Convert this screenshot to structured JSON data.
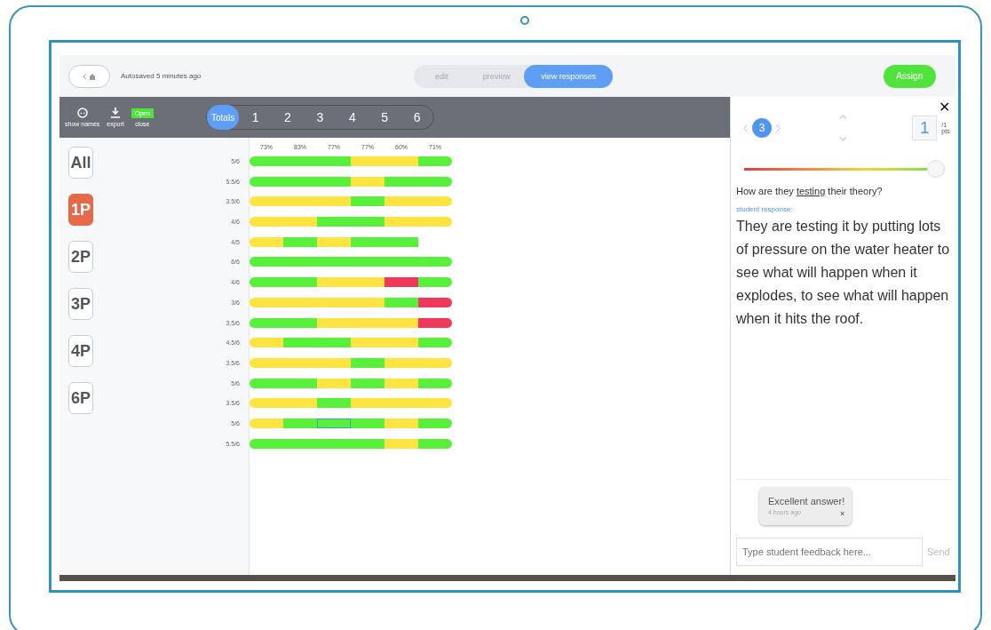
{
  "topbar": {
    "autosave": "Autosaved 5 minutes ago",
    "modes": [
      {
        "label": "edit",
        "selected": false
      },
      {
        "label": "preview",
        "selected": false
      },
      {
        "label": "view responses",
        "selected": true
      }
    ],
    "assign": "Assign"
  },
  "toolbar": {
    "show_names": "show names",
    "export": "export",
    "status_badge": "Open",
    "close": "close",
    "tabs": [
      {
        "label": "Totals",
        "selected": true
      },
      {
        "label": "1",
        "selected": false
      },
      {
        "label": "2",
        "selected": false
      },
      {
        "label": "3",
        "selected": false
      },
      {
        "label": "4",
        "selected": false
      },
      {
        "label": "5",
        "selected": false
      },
      {
        "label": "6",
        "selected": false
      }
    ]
  },
  "periods": [
    {
      "label": "All",
      "selected": false
    },
    {
      "label": "1P",
      "selected": true
    },
    {
      "label": "2P",
      "selected": false
    },
    {
      "label": "3P",
      "selected": false
    },
    {
      "label": "4P",
      "selected": false
    },
    {
      "label": "6P",
      "selected": false
    }
  ],
  "question_percents": [
    "73%",
    "83%",
    "77%",
    "77%",
    "60%",
    "71%"
  ],
  "rows": [
    {
      "score": "5/6",
      "segments": [
        {
          "color": "#58f03a",
          "selected": false
        },
        {
          "color": "#58f03a",
          "selected": false
        },
        {
          "color": "#58f03a",
          "selected": false
        },
        {
          "color": "#fde441",
          "selected": false
        },
        {
          "color": "#fde441",
          "selected": false
        },
        {
          "color": "#58f03a",
          "selected": false
        }
      ]
    },
    {
      "score": "5.5/6",
      "segments": [
        {
          "color": "#58f03a",
          "selected": false
        },
        {
          "color": "#58f03a",
          "selected": false
        },
        {
          "color": "#58f03a",
          "selected": false
        },
        {
          "color": "#fde441",
          "selected": false
        },
        {
          "color": "#58f03a",
          "selected": false
        },
        {
          "color": "#58f03a",
          "selected": false
        }
      ]
    },
    {
      "score": "3.5/6",
      "segments": [
        {
          "color": "#fde441",
          "selected": false
        },
        {
          "color": "#fde441",
          "selected": false
        },
        {
          "color": "#fde441",
          "selected": false
        },
        {
          "color": "#58f03a",
          "selected": false
        },
        {
          "color": "#fde441",
          "selected": false
        },
        {
          "color": "#fde441",
          "selected": false
        }
      ]
    },
    {
      "score": "4/6",
      "segments": [
        {
          "color": "#fde441",
          "selected": false
        },
        {
          "color": "#fde441",
          "selected": false
        },
        {
          "color": "#58f03a",
          "selected": false
        },
        {
          "color": "#58f03a",
          "selected": false
        },
        {
          "color": "#fde441",
          "selected": false
        },
        {
          "color": "#fde441",
          "selected": false
        }
      ]
    },
    {
      "score": "4/5",
      "segments": [
        {
          "color": "#fde441",
          "selected": false
        },
        {
          "color": "#58f03a",
          "selected": false
        },
        {
          "color": "#fde441",
          "selected": false
        },
        {
          "color": "#58f03a",
          "selected": false
        },
        {
          "color": "#58f03a",
          "selected": false
        }
      ]
    },
    {
      "score": "6/6",
      "segments": [
        {
          "color": "#58f03a",
          "selected": false
        },
        {
          "color": "#58f03a",
          "selected": false
        },
        {
          "color": "#58f03a",
          "selected": false
        },
        {
          "color": "#58f03a",
          "selected": false
        },
        {
          "color": "#58f03a",
          "selected": false
        },
        {
          "color": "#58f03a",
          "selected": false
        }
      ]
    },
    {
      "score": "4/6",
      "segments": [
        {
          "color": "#58f03a",
          "selected": false
        },
        {
          "color": "#58f03a",
          "selected": false
        },
        {
          "color": "#fde441",
          "selected": false
        },
        {
          "color": "#fde441",
          "selected": false
        },
        {
          "color": "#f0385a",
          "selected": false
        },
        {
          "color": "#58f03a",
          "selected": false
        }
      ]
    },
    {
      "score": "3/6",
      "segments": [
        {
          "color": "#fde441",
          "selected": false
        },
        {
          "color": "#fde441",
          "selected": false
        },
        {
          "color": "#fde441",
          "selected": false
        },
        {
          "color": "#fde441",
          "selected": false
        },
        {
          "color": "#58f03a",
          "selected": false
        },
        {
          "color": "#f0385a",
          "selected": false
        }
      ]
    },
    {
      "score": "3.5/6",
      "segments": [
        {
          "color": "#58f03a",
          "selected": false
        },
        {
          "color": "#58f03a",
          "selected": false
        },
        {
          "color": "#fde441",
          "selected": false
        },
        {
          "color": "#fde441",
          "selected": false
        },
        {
          "color": "#fde441",
          "selected": false
        },
        {
          "color": "#f0385a",
          "selected": false
        }
      ]
    },
    {
      "score": "4.5/6",
      "segments": [
        {
          "color": "#fde441",
          "selected": false
        },
        {
          "color": "#58f03a",
          "selected": false
        },
        {
          "color": "#58f03a",
          "selected": false
        },
        {
          "color": "#fde441",
          "selected": false
        },
        {
          "color": "#fde441",
          "selected": false
        },
        {
          "color": "#58f03a",
          "selected": false
        }
      ]
    },
    {
      "score": "3.5/6",
      "segments": [
        {
          "color": "#fde441",
          "selected": false
        },
        {
          "color": "#fde441",
          "selected": false
        },
        {
          "color": "#fde441",
          "selected": false
        },
        {
          "color": "#58f03a",
          "selected": false
        },
        {
          "color": "#fde441",
          "selected": false
        },
        {
          "color": "#fde441",
          "selected": false
        }
      ]
    },
    {
      "score": "5/6",
      "segments": [
        {
          "color": "#58f03a",
          "selected": false
        },
        {
          "color": "#58f03a",
          "selected": false
        },
        {
          "color": "#fde441",
          "selected": false
        },
        {
          "color": "#58f03a",
          "selected": false
        },
        {
          "color": "#fde441",
          "selected": false
        },
        {
          "color": "#58f03a",
          "selected": false
        }
      ]
    },
    {
      "score": "3.5/6",
      "segments": [
        {
          "color": "#fde441",
          "selected": false
        },
        {
          "color": "#fde441",
          "selected": false
        },
        {
          "color": "#58f03a",
          "selected": false
        },
        {
          "color": "#fde441",
          "selected": false
        },
        {
          "color": "#fde441",
          "selected": false
        },
        {
          "color": "#fde441",
          "selected": false
        }
      ]
    },
    {
      "score": "5/6",
      "segments": [
        {
          "color": "#fde441",
          "selected": false
        },
        {
          "color": "#58f03a",
          "selected": false
        },
        {
          "color": "#58f03a",
          "selected": true
        },
        {
          "color": "#58f03a",
          "selected": false
        },
        {
          "color": "#fde441",
          "selected": false
        },
        {
          "color": "#58f03a",
          "selected": false
        }
      ]
    },
    {
      "score": "5.5/6",
      "segments": [
        {
          "color": "#58f03a",
          "selected": false
        },
        {
          "color": "#58f03a",
          "selected": false
        },
        {
          "color": "#58f03a",
          "selected": false
        },
        {
          "color": "#58f03a",
          "selected": false
        },
        {
          "color": "#fde441",
          "selected": false
        },
        {
          "color": "#58f03a",
          "selected": false
        }
      ]
    }
  ],
  "detail": {
    "question_number": "3",
    "points": "1",
    "points_total": "/1",
    "points_unit": "pts",
    "score_slider": {
      "level": 1.0
    },
    "question_before": "How are they ",
    "question_link": "testing",
    "question_after": " their theory?",
    "response_label": "student response:",
    "response": "They are testing it by putting lots of pressure on the water heater to see what will happen when it explodes, to see what will happen when it hits the roof.",
    "feedback": [
      {
        "text": "Excellent answer!",
        "time": "4 hours ago",
        "remove": "×"
      }
    ],
    "feedback_placeholder": "Type student feedback here...",
    "send": "Send",
    "close": "✕"
  }
}
